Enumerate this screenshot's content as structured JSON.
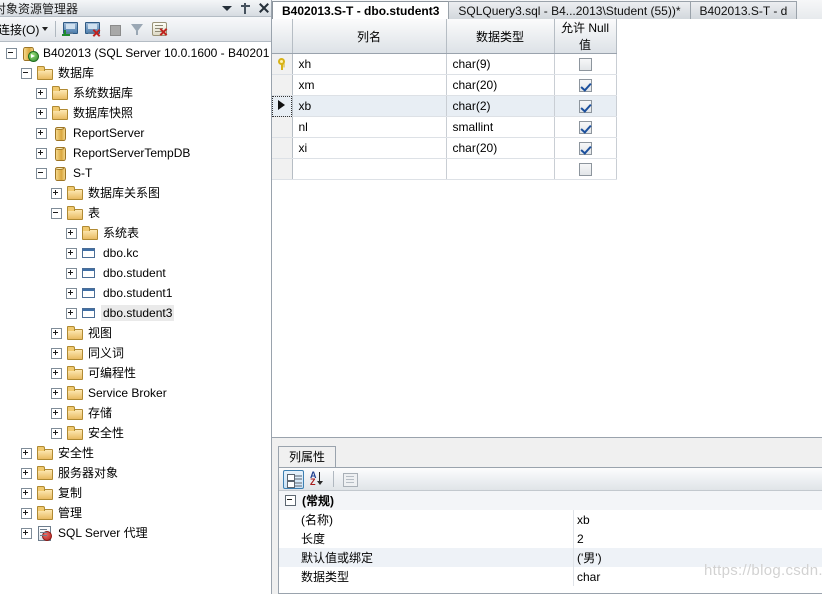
{
  "explorer": {
    "title": "对象资源管理器",
    "titlebar_buttons": [
      {
        "name": "window-dropdown-icon"
      },
      {
        "name": "auto-hide-pin-icon"
      },
      {
        "name": "close-icon"
      }
    ],
    "toolbar": {
      "connect_label": "连接(O)",
      "buttons": [
        {
          "name": "connect-server-icon"
        },
        {
          "name": "disconnect-server-icon"
        },
        {
          "name": "stop-icon"
        },
        {
          "name": "filter-icon"
        },
        {
          "name": "refresh-icon"
        }
      ]
    },
    "tree": [
      {
        "label": "B402013 (SQL Server 10.0.1600 - B40201",
        "indent": 0,
        "state": "minus",
        "icon": "server",
        "selected": false
      },
      {
        "label": "数据库",
        "indent": 1,
        "state": "minus",
        "icon": "folder",
        "selected": false
      },
      {
        "label": "系统数据库",
        "indent": 2,
        "state": "plus",
        "icon": "folder",
        "selected": false
      },
      {
        "label": "数据库快照",
        "indent": 2,
        "state": "plus",
        "icon": "folder",
        "selected": false
      },
      {
        "label": "ReportServer",
        "indent": 2,
        "state": "plus",
        "icon": "db",
        "selected": false
      },
      {
        "label": "ReportServerTempDB",
        "indent": 2,
        "state": "plus",
        "icon": "db",
        "selected": false
      },
      {
        "label": "S-T",
        "indent": 2,
        "state": "minus",
        "icon": "db",
        "selected": false
      },
      {
        "label": "数据库关系图",
        "indent": 3,
        "state": "plus",
        "icon": "folder",
        "selected": false
      },
      {
        "label": "表",
        "indent": 3,
        "state": "minus",
        "icon": "folder",
        "selected": false
      },
      {
        "label": "系统表",
        "indent": 4,
        "state": "plus",
        "icon": "folder",
        "selected": false
      },
      {
        "label": "dbo.kc",
        "indent": 4,
        "state": "plus",
        "icon": "table",
        "selected": false
      },
      {
        "label": "dbo.student",
        "indent": 4,
        "state": "plus",
        "icon": "table",
        "selected": false
      },
      {
        "label": "dbo.student1",
        "indent": 4,
        "state": "plus",
        "icon": "table",
        "selected": false
      },
      {
        "label": "dbo.student3",
        "indent": 4,
        "state": "plus",
        "icon": "table",
        "selected": true
      },
      {
        "label": "视图",
        "indent": 3,
        "state": "plus",
        "icon": "folder",
        "selected": false
      },
      {
        "label": "同义词",
        "indent": 3,
        "state": "plus",
        "icon": "folder",
        "selected": false
      },
      {
        "label": "可编程性",
        "indent": 3,
        "state": "plus",
        "icon": "folder",
        "selected": false
      },
      {
        "label": "Service Broker",
        "indent": 3,
        "state": "plus",
        "icon": "folder",
        "selected": false
      },
      {
        "label": "存储",
        "indent": 3,
        "state": "plus",
        "icon": "folder",
        "selected": false
      },
      {
        "label": "安全性",
        "indent": 3,
        "state": "plus",
        "icon": "folder",
        "selected": false
      },
      {
        "label": "安全性",
        "indent": 1,
        "state": "plus",
        "icon": "folder",
        "selected": false
      },
      {
        "label": "服务器对象",
        "indent": 1,
        "state": "plus",
        "icon": "folder",
        "selected": false
      },
      {
        "label": "复制",
        "indent": 1,
        "state": "plus",
        "icon": "folder",
        "selected": false
      },
      {
        "label": "管理",
        "indent": 1,
        "state": "plus",
        "icon": "folder",
        "selected": false
      },
      {
        "label": "SQL Server 代理",
        "indent": 1,
        "state": "plus",
        "icon": "agent",
        "selected": false
      }
    ]
  },
  "tabs": [
    {
      "label": "B402013.S-T - dbo.student3",
      "active": true
    },
    {
      "label": "SQLQuery3.sql - B4...2013\\Student (55))*",
      "active": false
    },
    {
      "label": "B402013.S-T - d",
      "active": false
    }
  ],
  "designer": {
    "headers": [
      "",
      "列名",
      "数据类型",
      "允许 Null 值"
    ],
    "rows": [
      {
        "marker": "key",
        "name": "xh",
        "type": "char(9)",
        "allow_null": false,
        "selected": false
      },
      {
        "marker": "",
        "name": "xm",
        "type": "char(20)",
        "allow_null": true,
        "selected": false
      },
      {
        "marker": "arrow",
        "name": "xb",
        "type": "char(2)",
        "allow_null": true,
        "selected": true
      },
      {
        "marker": "",
        "name": "nl",
        "type": "smallint",
        "allow_null": true,
        "selected": false
      },
      {
        "marker": "",
        "name": "xi",
        "type": "char(20)",
        "allow_null": true,
        "selected": false
      },
      {
        "marker": "",
        "name": "",
        "type": "",
        "allow_null": false,
        "selected": false
      }
    ]
  },
  "properties": {
    "tab_label": "列属性",
    "toolbar": [
      {
        "name": "categorized-sort-icon"
      },
      {
        "name": "alphabetical-sort-icon"
      },
      {
        "name": "property-pages-icon"
      }
    ],
    "category": "(常规)",
    "rows": [
      {
        "key": "(名称)",
        "value": "xb",
        "highlight": false
      },
      {
        "key": "长度",
        "value": "2",
        "highlight": false
      },
      {
        "key": "默认值或绑定",
        "value": "('男')",
        "highlight": true
      },
      {
        "key": "数据类型",
        "value": "char",
        "highlight": false
      }
    ]
  },
  "watermark": "https://blog.csdn.net/Dhhjk"
}
